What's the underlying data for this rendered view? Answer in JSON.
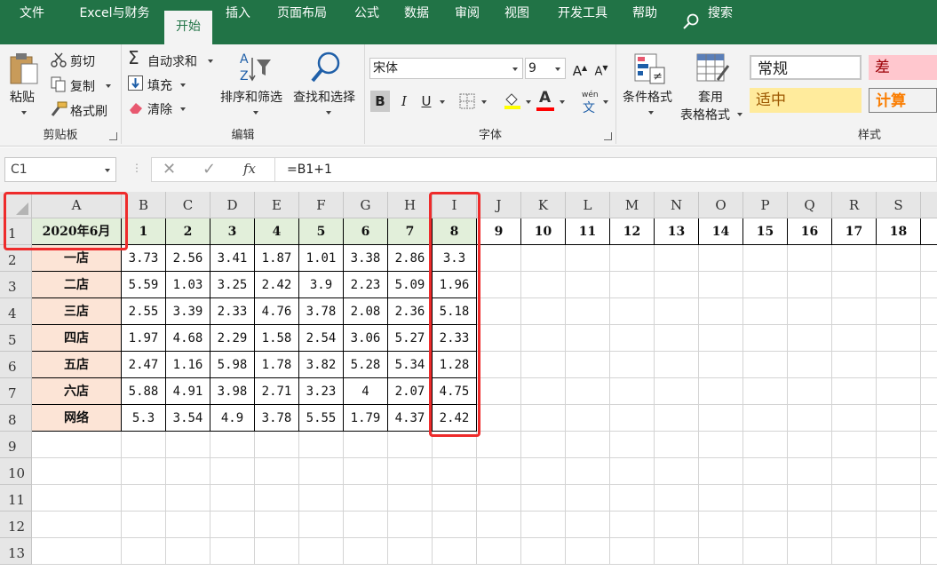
{
  "menu": {
    "tabs": [
      {
        "label": "文件"
      },
      {
        "label": "Excel与财务"
      },
      {
        "label": "开始"
      },
      {
        "label": "插入"
      },
      {
        "label": "页面布局"
      },
      {
        "label": "公式"
      },
      {
        "label": "数据"
      },
      {
        "label": "审阅"
      },
      {
        "label": "视图"
      },
      {
        "label": "开发工具"
      },
      {
        "label": "帮助"
      },
      {
        "label": "搜索"
      }
    ],
    "active_tab": "开始"
  },
  "ribbon": {
    "clipboard": {
      "paste": "粘贴",
      "cut": "剪切",
      "copy": "复制",
      "format_painter": "格式刷",
      "group_label": "剪贴板"
    },
    "editing": {
      "autosum": "自动求和",
      "fill": "填充",
      "clear": "清除",
      "sort_filter": "排序和筛选",
      "find_select": "查找和选择",
      "group_label": "编辑"
    },
    "font": {
      "font_name": "宋体",
      "font_size": "9",
      "bold": "B",
      "italic": "I",
      "underline": "U",
      "phonetic": "wén",
      "phonetic_char": "文",
      "font_color_glyph": "A",
      "grow": "A",
      "shrink": "A",
      "group_label": "字体"
    },
    "styles": {
      "conditional": "条件格式",
      "table_line1": "套用",
      "table_line2": "表格格式",
      "normal": "常规",
      "bad": "差",
      "neutral": "适中",
      "calc": "计算",
      "group_label": "样式"
    }
  },
  "formula_bar": {
    "name_box": "C1",
    "fx": "fx",
    "formula": "=B1+1"
  },
  "sheet": {
    "columns": [
      "A",
      "B",
      "C",
      "D",
      "E",
      "F",
      "G",
      "H",
      "I",
      "J",
      "K",
      "L",
      "M",
      "N",
      "O",
      "P",
      "Q",
      "R",
      "S"
    ],
    "rows": [
      "1",
      "2",
      "3",
      "4",
      "5",
      "6",
      "7",
      "8",
      "9",
      "10",
      "11",
      "12",
      "13"
    ],
    "header_row": [
      "2020年6月",
      "1",
      "2",
      "3",
      "4",
      "5",
      "6",
      "7",
      "8",
      "9",
      "10",
      "11",
      "12",
      "13",
      "14",
      "15",
      "16",
      "17",
      "18"
    ],
    "stores": [
      "一店",
      "二店",
      "三店",
      "四店",
      "五店",
      "六店",
      "网络"
    ],
    "values": [
      [
        "3.73",
        "2.56",
        "3.41",
        "1.87",
        "1.01",
        "3.38",
        "2.86",
        "3.3"
      ],
      [
        "5.59",
        "1.03",
        "3.25",
        "2.42",
        "3.9",
        "2.23",
        "5.09",
        "1.96"
      ],
      [
        "2.55",
        "3.39",
        "2.33",
        "4.76",
        "3.78",
        "2.08",
        "2.36",
        "5.18"
      ],
      [
        "1.97",
        "4.68",
        "2.29",
        "1.58",
        "2.54",
        "3.06",
        "5.27",
        "2.33"
      ],
      [
        "2.47",
        "1.16",
        "5.98",
        "1.78",
        "3.82",
        "5.28",
        "5.34",
        "1.28"
      ],
      [
        "5.88",
        "4.91",
        "3.98",
        "2.71",
        "3.23",
        "4",
        "2.07",
        "4.75"
      ],
      [
        "5.3",
        "3.54",
        "4.9",
        "3.78",
        "5.55",
        "1.79",
        "4.37",
        "2.42"
      ]
    ]
  },
  "colors": {
    "excel_green": "#217346",
    "header_fill": "#e2efda",
    "store_fill": "#fce4d6",
    "highlight_box": "#ee2b2b"
  }
}
